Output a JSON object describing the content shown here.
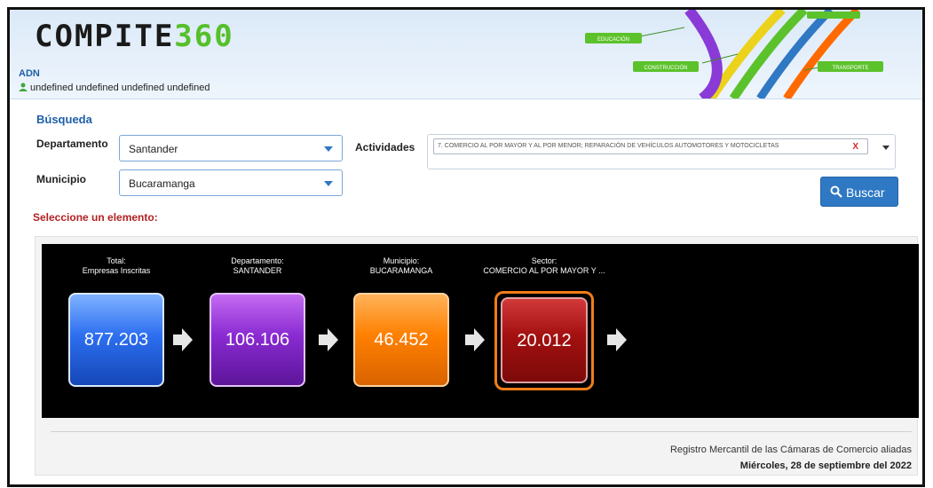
{
  "app": {
    "logo_text_1": "COMPITE",
    "logo_text_2": "360",
    "module": "ADN",
    "user_line": "undefined undefined undefined undefined"
  },
  "banner": {
    "tags": [
      "EDUCACIÓN",
      "CONSTRUCCIÓN",
      "TRANSPORTE"
    ],
    "colors": {
      "tag_green": "#5cc22b",
      "strand_purple": "#8a3ad6",
      "strand_blue": "#2f78c4",
      "strand_yellow": "#ecd21a",
      "strand_orange": "#ff6a00"
    }
  },
  "search": {
    "title": "Búsqueda",
    "departamento_label": "Departamento",
    "departamento_value": "Santander",
    "municipio_label": "Municipio",
    "municipio_value": "Bucaramanga",
    "actividades_label": "Actividades",
    "actividad_tag": "7. COMERCIO AL POR MAYOR Y AL POR MENOR; REPARACIÓN DE VEHÍCULOS AUTOMOTORES Y MOTOCICLETAS",
    "remove_tag": "X",
    "search_button": "Buscar"
  },
  "prompt": "Seleccione un elemento:",
  "funnel": [
    {
      "caption_1": "Total:",
      "caption_2": "Empresas Inscritas",
      "value": "877.203",
      "color": "#2d6ff0"
    },
    {
      "caption_1": "Departamento:",
      "caption_2": "SANTANDER",
      "value": "106.106",
      "color": "#8a2bd2"
    },
    {
      "caption_1": "Municipio:",
      "caption_2": "BUCARAMANGA",
      "value": "46.452",
      "color": "#ff8000"
    },
    {
      "caption_1": "Sector:",
      "caption_2": "COMERCIO AL POR MAYOR Y ...",
      "value": "20.012",
      "color": "#a31010",
      "selected": true
    }
  ],
  "footer": {
    "source": "Registro Mercantil de las Cámaras de Comercio aliadas",
    "date": "Miércoles, 28 de septiembre del 2022"
  }
}
